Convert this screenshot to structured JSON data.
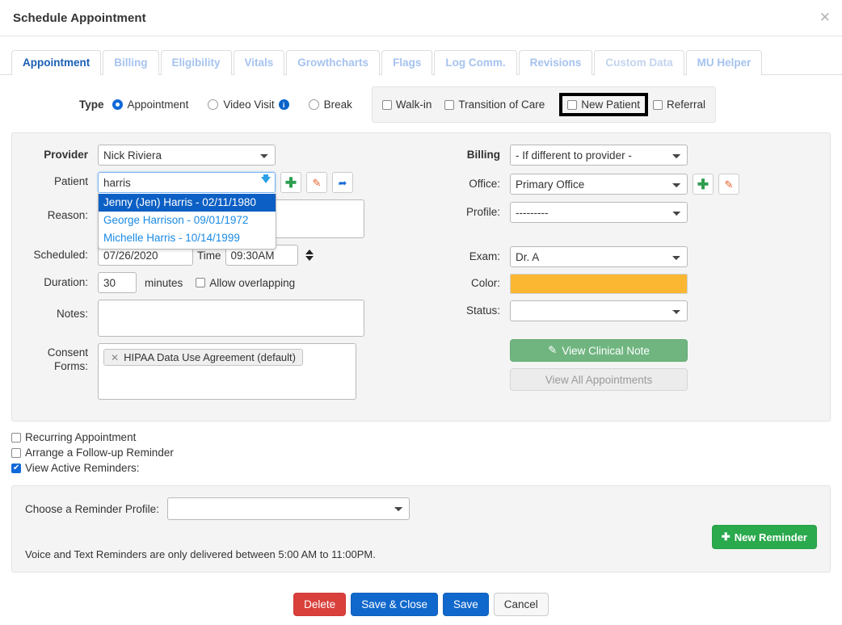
{
  "header": {
    "title": "Schedule Appointment",
    "close_icon": "close-icon"
  },
  "tabs": [
    {
      "label": "Appointment",
      "state": "active"
    },
    {
      "label": "Billing",
      "state": "normal"
    },
    {
      "label": "Eligibility",
      "state": "normal"
    },
    {
      "label": "Vitals",
      "state": "normal"
    },
    {
      "label": "Growthcharts",
      "state": "normal"
    },
    {
      "label": "Flags",
      "state": "normal"
    },
    {
      "label": "Log Comm.",
      "state": "normal"
    },
    {
      "label": "Revisions",
      "state": "normal"
    },
    {
      "label": "Custom Data",
      "state": "muted"
    },
    {
      "label": "MU Helper",
      "state": "normal"
    }
  ],
  "type_row": {
    "label": "Type",
    "radios": [
      {
        "label": "Appointment",
        "checked": true
      },
      {
        "label": "Video Visit",
        "checked": false,
        "info_icon": "info-icon"
      },
      {
        "label": "Break",
        "checked": false
      }
    ],
    "checkboxes": [
      {
        "label": "Walk-in",
        "checked": false,
        "highlighted": false
      },
      {
        "label": "Transition of Care",
        "checked": false,
        "highlighted": false
      },
      {
        "label": "New Patient",
        "checked": false,
        "highlighted": true
      },
      {
        "label": "Referral",
        "checked": false,
        "highlighted": false
      }
    ]
  },
  "form_left": {
    "provider": {
      "label": "Provider",
      "value": "Nick Riviera"
    },
    "patient": {
      "label": "Patient",
      "value": "harris",
      "dropdown_icon": "chevron-down-icon",
      "add_icon": "plus-icon",
      "edit_icon": "pencil-icon",
      "open_icon": "external-link-icon",
      "suggestions": [
        {
          "text": "Jenny (Jen) Harris - 02/11/1980",
          "selected": true
        },
        {
          "text": "George Harrison - 09/01/1972",
          "selected": false
        },
        {
          "text": "Michelle Harris - 10/14/1999",
          "selected": false
        }
      ]
    },
    "reason": {
      "label": "Reason:",
      "value": ""
    },
    "scheduled": {
      "label": "Scheduled:",
      "date": "07/26/2020",
      "time_label": "Time",
      "time": "09:30AM",
      "stepper_icon": "up-down-stepper-icon"
    },
    "duration": {
      "label": "Duration:",
      "value": "30",
      "unit": "minutes",
      "allow_overlapping_label": "Allow overlapping",
      "allow_overlapping_checked": false
    },
    "notes": {
      "label": "Notes:",
      "value": ""
    },
    "consent": {
      "label_line1": "Consent",
      "label_line2": "Forms:",
      "tags": [
        {
          "text": "HIPAA Data Use Agreement (default)",
          "remove_icon": "remove-tag-icon"
        }
      ]
    }
  },
  "form_right": {
    "billing": {
      "label": "Billing",
      "value": "- If different to provider -"
    },
    "office": {
      "label": "Office:",
      "value": "Primary Office",
      "add_icon": "plus-icon",
      "edit_icon": "pencil-icon"
    },
    "profile": {
      "label": "Profile:",
      "value": "---------"
    },
    "exam": {
      "label": "Exam:",
      "value": "Dr. A"
    },
    "color": {
      "label": "Color:",
      "value": "#fbb731"
    },
    "status": {
      "label": "Status:",
      "value": ""
    },
    "clinical_note_button": {
      "label": "View Clinical Note",
      "icon": "edit-note-icon"
    },
    "all_appointments_button": {
      "label": "View All Appointments"
    }
  },
  "reminders": {
    "recurring": {
      "label": "Recurring Appointment",
      "checked": false
    },
    "followup": {
      "label": "Arrange a Follow-up Reminder",
      "checked": false
    },
    "view_active": {
      "label": "View Active Reminders:",
      "checked": true
    },
    "profile_label": "Choose a Reminder Profile:",
    "profile_value": "",
    "new_reminder_button": {
      "label": "New Reminder",
      "icon": "plus-icon"
    },
    "note": "Voice and Text Reminders are only delivered between 5:00 AM to 11:00PM."
  },
  "footer": {
    "delete": "Delete",
    "save_close": "Save & Close",
    "save": "Save",
    "cancel": "Cancel"
  }
}
